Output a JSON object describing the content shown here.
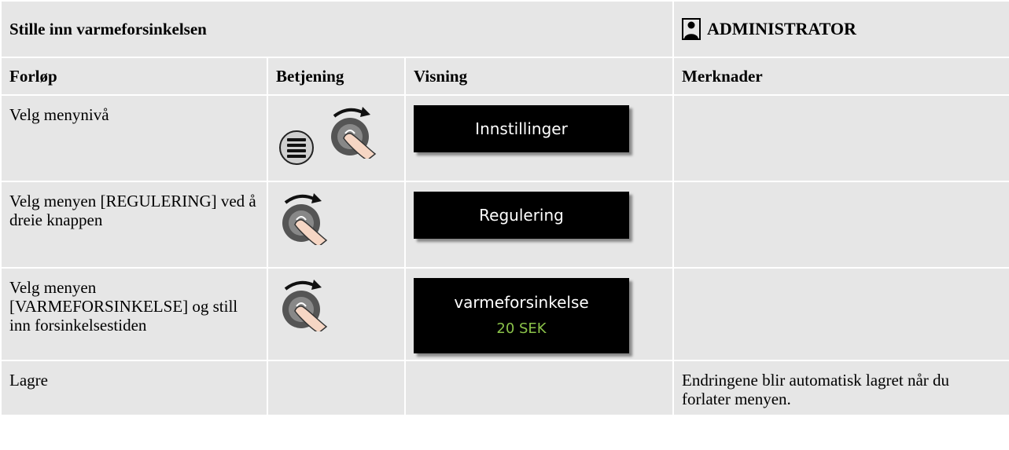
{
  "header": {
    "title": "Stille inn varmeforsinkelsen",
    "role": "ADMINISTRATOR"
  },
  "columns": {
    "col1": "Forløp",
    "col2": "Betjening",
    "col3": "Visning",
    "col4": "Merknader"
  },
  "rows": [
    {
      "step": "Velg menynivå",
      "display": "Innstillinger",
      "display_value": "",
      "note": ""
    },
    {
      "step": "Velg menyen [REGULERING] ved å dreie knappen",
      "display": "Regulering",
      "display_value": "",
      "note": ""
    },
    {
      "step": "Velg menyen [VARMEFORSINKELSE] og still inn forsinkelsestiden",
      "display": "varmeforsinkelse",
      "display_value": "20 SEK",
      "note": ""
    },
    {
      "step": "Lagre",
      "display": "",
      "display_value": "",
      "note": "Endringene blir automatisk lagret når du forlater menyen."
    }
  ],
  "colors": {
    "cell_bg": "#e6e6e6",
    "display_bg": "#000000",
    "display_value": "#8bc34a"
  },
  "icons": {
    "role": "person-icon",
    "menu": "menu-button-icon",
    "knob": "rotary-knob-icon"
  }
}
